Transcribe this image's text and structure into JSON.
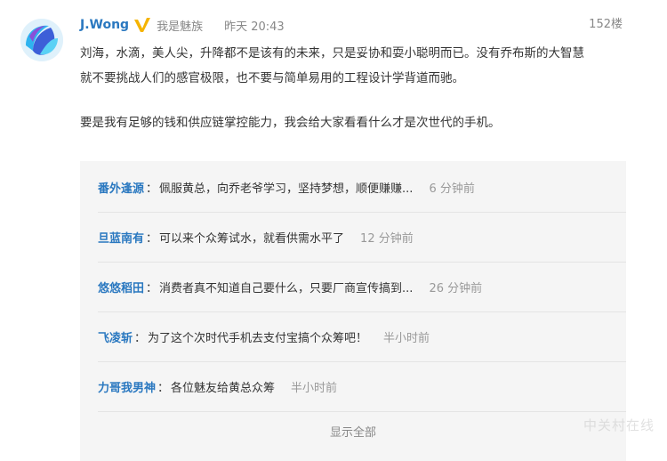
{
  "post": {
    "username": "J.Wong",
    "group": "我是魅族",
    "time": "昨天 20:43",
    "floor": "152楼",
    "paragraphs": [
      "刘海，水滴，美人尖，升降都不是该有的未来，只是妥协和耍小聪明而已。没有乔布斯的大智慧",
      "就不要挑战人们的感官极限，也不要与简单易用的工程设计学背道而驰。",
      "要是我有足够的钱和供应链掌控能力，我会给大家看看什么才是次世代的手机。"
    ]
  },
  "replies": [
    {
      "name": "番外逢源",
      "text": "佩服黄总，向乔老爷学习，坚持梦想，顺便赚赚...",
      "time": "6 分钟前"
    },
    {
      "name": "旦蓝南有",
      "text": "可以来个众筹试水，就看供需水平了",
      "time": "12 分钟前"
    },
    {
      "name": "悠悠稻田",
      "text": "消费者真不知道自己要什么，只要厂商宣传搞到...",
      "time": "26 分钟前"
    },
    {
      "name": "飞凌斩",
      "text": "为了这个次时代手机去支付宝搞个众筹吧！",
      "time": "半小时前"
    },
    {
      "name": "力哥我男神",
      "text": "各位魅友给黄总众筹",
      "time": "半小时前"
    }
  ],
  "show_all": "显示全部",
  "watermark": "中关村在线",
  "colors": {
    "link": "#2a78c0",
    "verify": "#f5b400",
    "panel": "#f5f5f5"
  },
  "icons": {
    "verify": "v-verified-icon",
    "avatar": "meizu-avatar"
  }
}
